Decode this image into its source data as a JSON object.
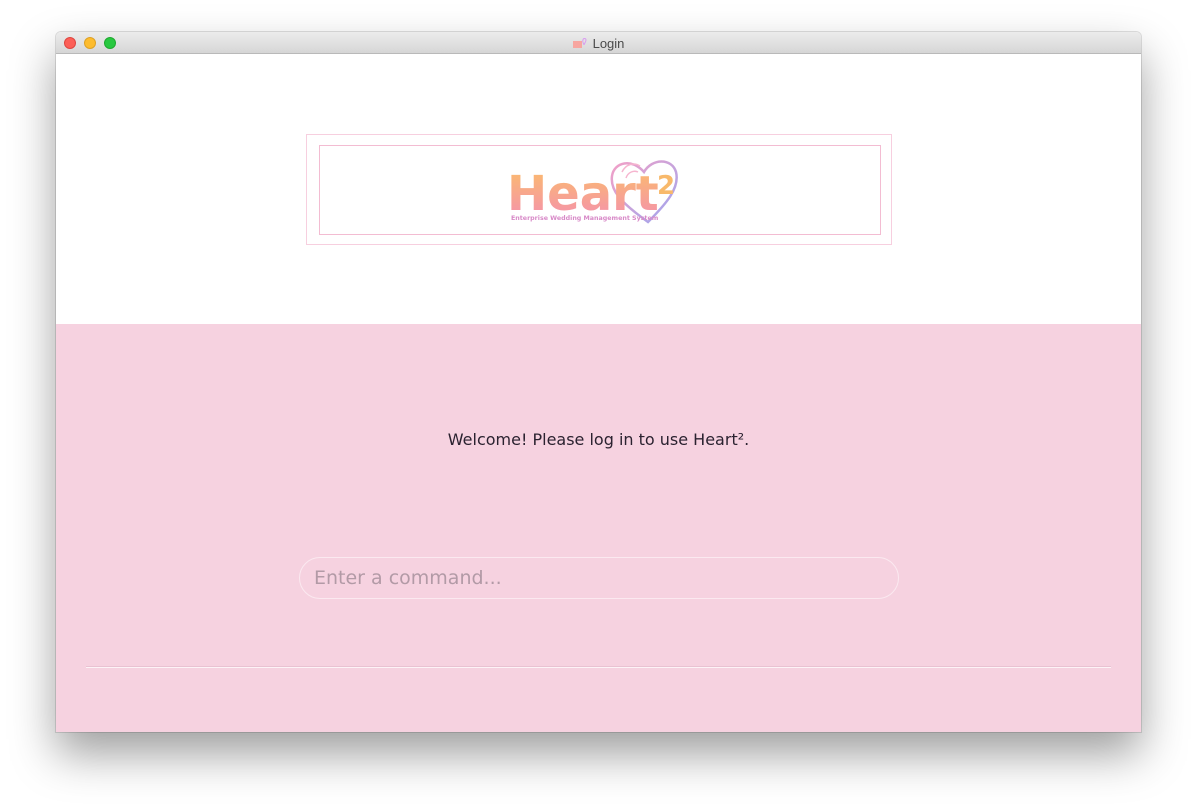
{
  "window": {
    "title": "Login",
    "controls": [
      "close",
      "minimize",
      "zoom"
    ]
  },
  "logo": {
    "brand": "Heart",
    "superscript": "2",
    "tagline": "Enterprise Wedding Management System",
    "icon": "heart-logo"
  },
  "main": {
    "welcome_text": "Welcome! Please log in to use Heart².",
    "command_placeholder": "Enter a command...",
    "command_value": ""
  },
  "colors": {
    "pane_pink": "#f6d2e0",
    "logo_gradient_start": "#fab66c",
    "logo_gradient_end": "#f48fb1",
    "heart_stroke": "#c79bf2"
  }
}
